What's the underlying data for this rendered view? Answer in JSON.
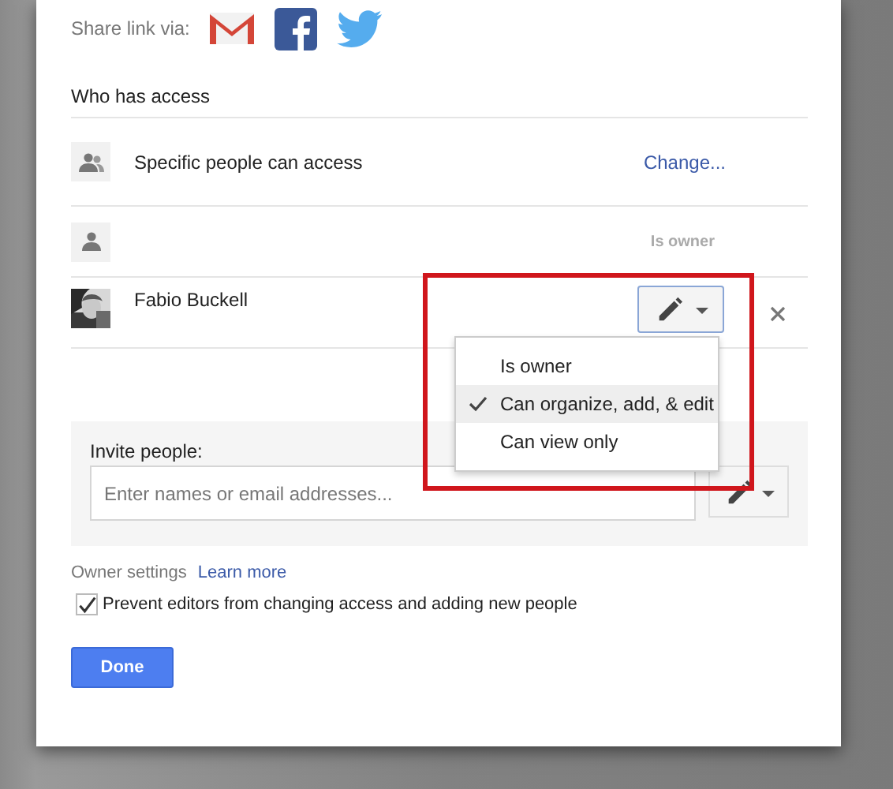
{
  "share": {
    "label": "Share link via:",
    "services": [
      {
        "kind": "gmail"
      },
      {
        "kind": "facebook"
      },
      {
        "kind": "twitter"
      }
    ]
  },
  "access": {
    "heading": "Who has access",
    "rows": [
      {
        "kind": "link",
        "label": "Specific people can access",
        "action": "Change..."
      },
      {
        "kind": "owner",
        "role": "Is owner"
      },
      {
        "kind": "person",
        "name": "Fabio Buckell"
      }
    ]
  },
  "permission_menu": {
    "items": [
      {
        "label": "Is owner",
        "selected": false
      },
      {
        "label": "Can organize, add, & edit",
        "selected": true
      },
      {
        "label": "Can view only",
        "selected": false
      }
    ]
  },
  "invite": {
    "label": "Invite people:",
    "placeholder": "Enter names or email addresses..."
  },
  "owner_settings": {
    "label": "Owner settings",
    "link": "Learn more",
    "options": [
      {
        "label": "Prevent editors from changing access and adding new people",
        "checked": true
      }
    ]
  },
  "buttons": [
    {
      "label": "Done"
    }
  ]
}
